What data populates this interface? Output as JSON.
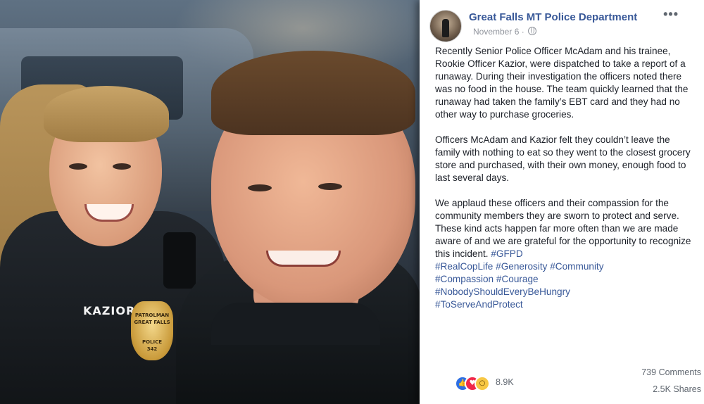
{
  "post": {
    "page_name": "Great Falls MT Police Department",
    "date": "November 6",
    "date_separator": "·",
    "more_menu": "•••",
    "paragraphs": [
      "Recently Senior Police Officer McAdam and his trainee, Rookie Officer Kazior, were dispatched to take a report of a runaway. During their investigation the officers noted there was no food in the house. The team quickly learned that the runaway had taken the family’s EBT card and they had no other way to purchase groceries.",
      "Officers McAdam and Kazior felt they couldn’t leave the family with nothing to eat so they went to the closest grocery store and purchased, with their own money, enough food to last several days.",
      "We applaud these officers and their compassion for the community members they are sworn to protect and serve. These kind acts happen far more often than we are made aware of and we are grateful for the opportunity to recognize this incident."
    ],
    "hashtags": [
      "#GFPD",
      "#RealCopLife",
      "#Generosity",
      "#Community",
      "#Compassion",
      "#Courage",
      "#NobodyShouldEveryBeHungry",
      "#ToServeAndProtect"
    ],
    "reaction_count": "8.9K",
    "comments_count": "739 Comments",
    "shares_count": "2.5K Shares",
    "reaction_icons": [
      "like-icon",
      "love-icon",
      "wow-icon"
    ]
  },
  "photo": {
    "name_tag": "KAZIOR",
    "badge_top": "PATROLMAN",
    "badge_city": "GREAT FALLS",
    "badge_word": "POLICE",
    "badge_number": "342"
  }
}
